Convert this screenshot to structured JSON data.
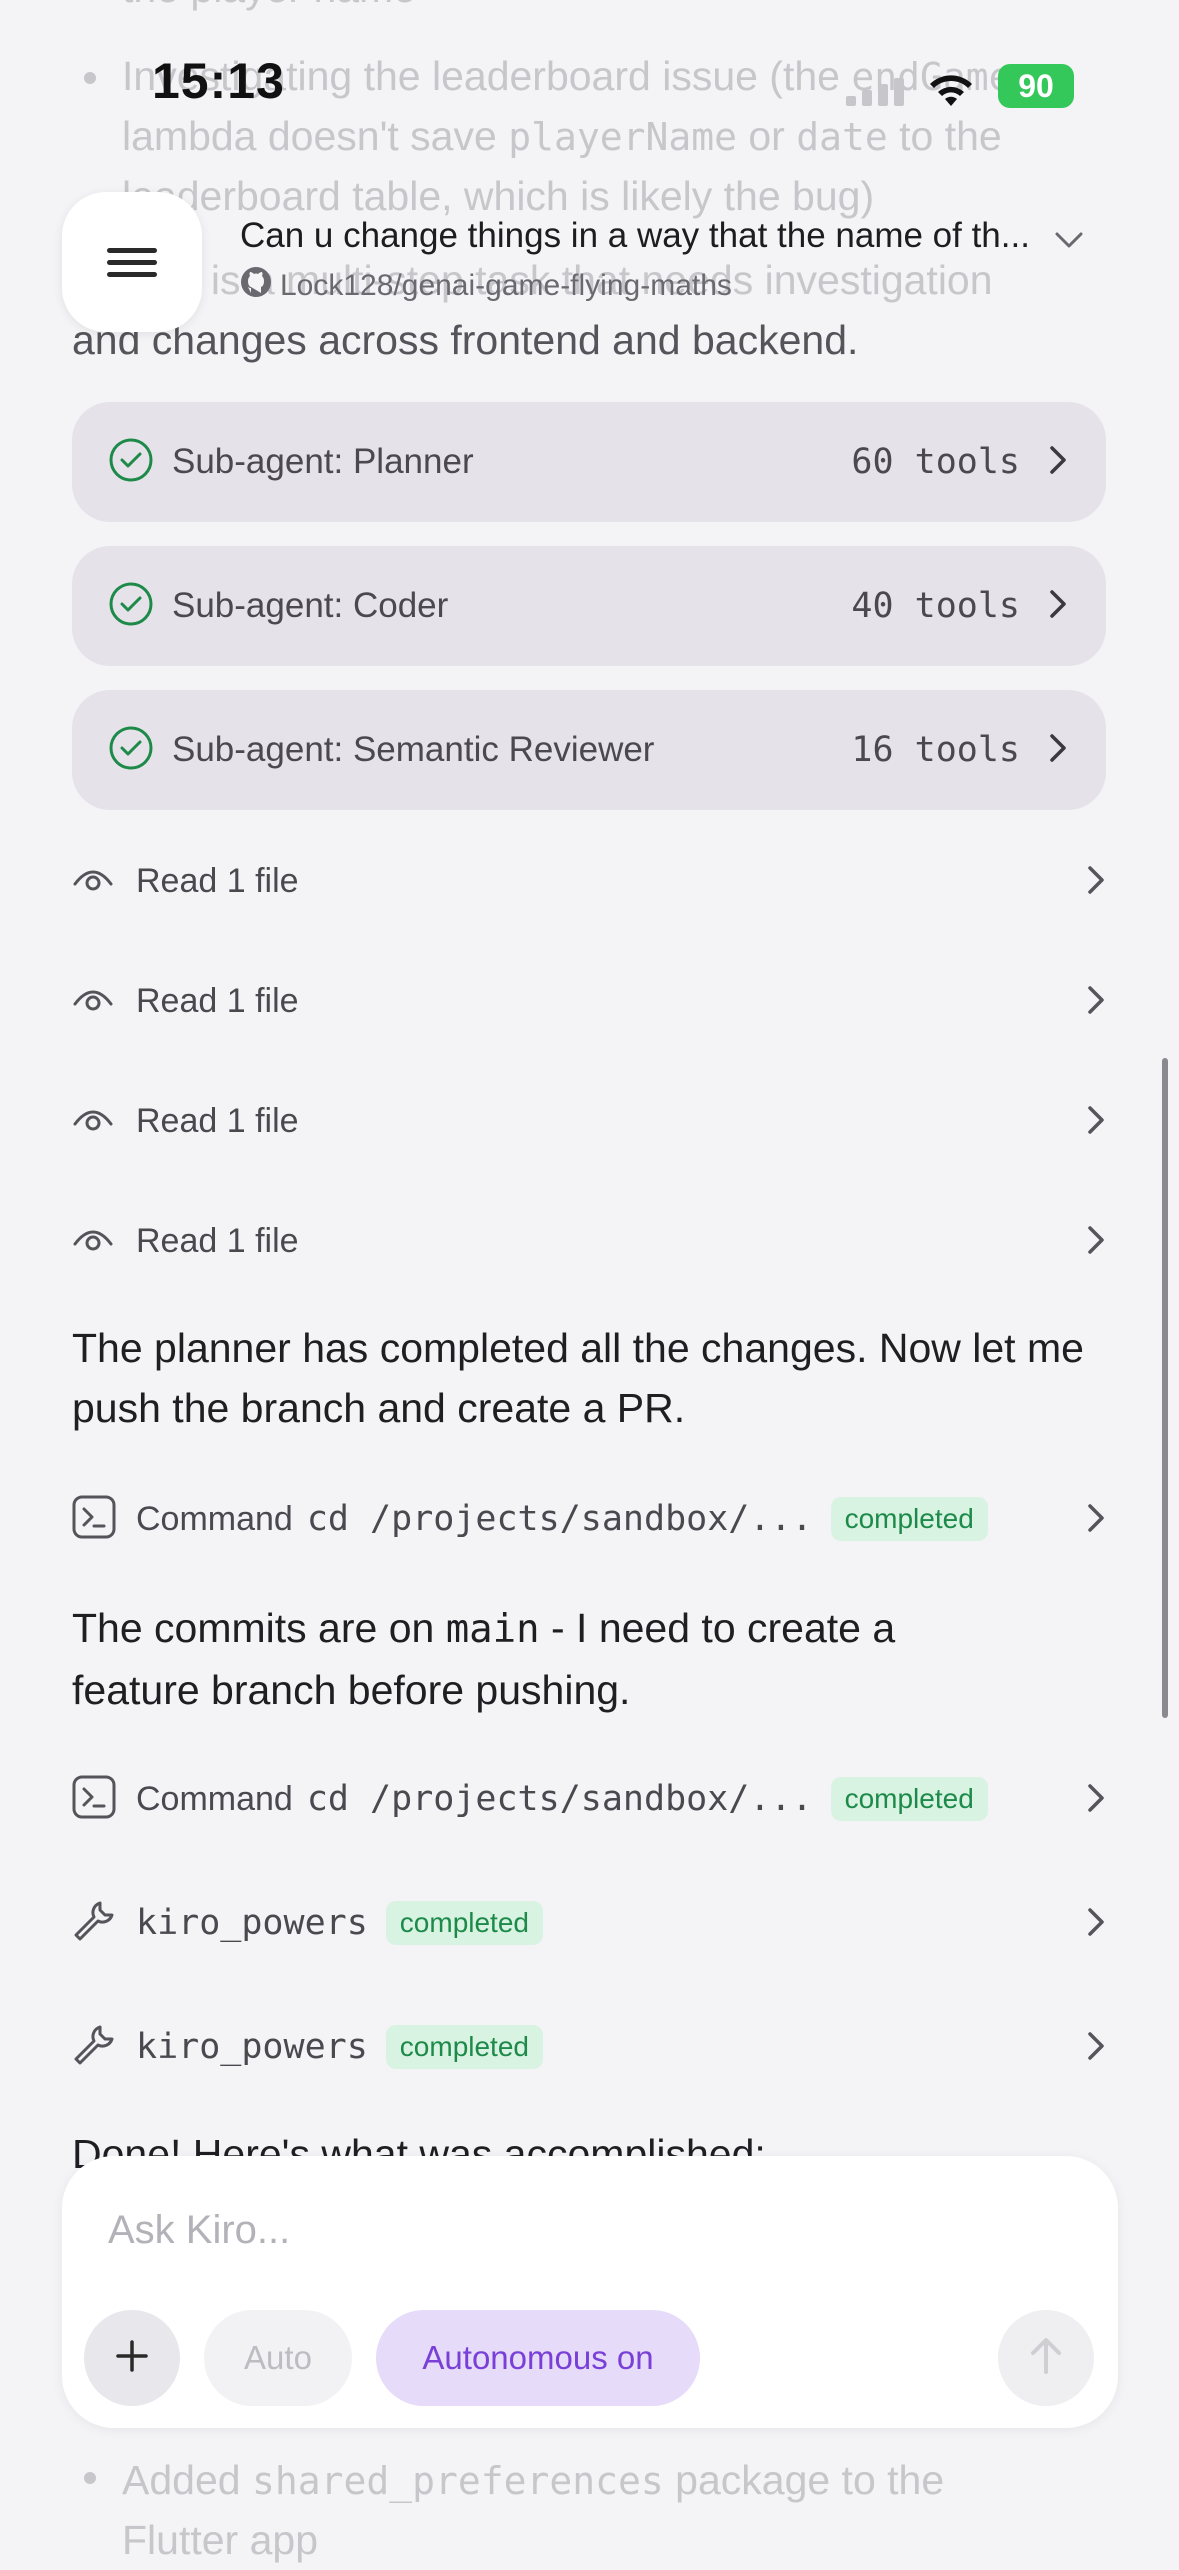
{
  "status_bar": {
    "time": "15:13",
    "battery": "90"
  },
  "background": {
    "top_clipped": "the player name",
    "bullet1_a": "Investigating the leaderboard issue (the ",
    "bullet1_code": "endGame",
    "bullet1_b": "lambda doesn't save ",
    "bullet1_code2": "playerName",
    "bullet1_c": " or ",
    "bullet1_code3": "date",
    "bullet1_d": " to the",
    "bullet1_e": "leaderboard table, which is likely the bug)",
    "line4": "This is a multi-step task that needs investigation",
    "line5": "and changes across frontend and backend.",
    "bottom_line1_a": "Added ",
    "bottom_line1_code": "shared_preferences",
    "bottom_line1_b": " package to the",
    "bottom_line2": "Flutter app"
  },
  "header": {
    "title": "Can u change things in a way that the name of th...",
    "repo": "Lock128/genai-game-flying-maths"
  },
  "subagents": [
    {
      "label": "Sub-agent: Planner",
      "tools": "60 tools"
    },
    {
      "label": "Sub-agent: Coder",
      "tools": "40 tools"
    },
    {
      "label": "Sub-agent: Semantic Reviewer",
      "tools": "16 tools"
    }
  ],
  "read_rows": [
    "Read 1 file",
    "Read 1 file",
    "Read 1 file",
    "Read 1 file"
  ],
  "messages": {
    "planner_done": "The planner has completed all the changes. Now let me push the branch and create a PR.",
    "commits_a": "The commits are on ",
    "commits_code": "main",
    "commits_b": " - I need to create a",
    "commits_c": "feature branch before pushing.",
    "done": "Done! Here's what was accomplished:"
  },
  "commands": [
    {
      "label": "Command",
      "cmd": "cd /projects/sandbox/...",
      "status": "completed"
    },
    {
      "label": "Command",
      "cmd": "cd /projects/sandbox/...",
      "status": "completed"
    }
  ],
  "tools": [
    {
      "name": "kiro_powers",
      "status": "completed"
    },
    {
      "name": "kiro_powers",
      "status": "completed"
    }
  ],
  "composer": {
    "placeholder": "Ask Kiro...",
    "auto_label": "Auto",
    "autonomous_label": "Autonomous on"
  },
  "colors": {
    "accent_purple": "#7a3fd6",
    "success_green": "#1e8a4a",
    "card_bg": "#e5e3e9"
  }
}
